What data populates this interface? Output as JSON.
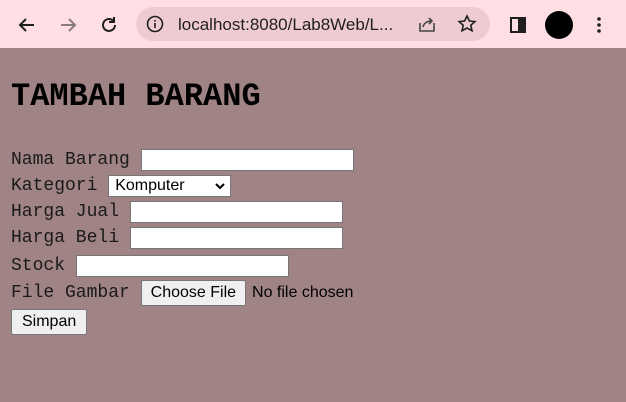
{
  "browser": {
    "url": "localhost:8080/Lab8Web/L...",
    "icons": {
      "back": "back-arrow-icon",
      "forward": "forward-arrow-icon",
      "reload": "reload-icon",
      "site_info": "site-info-icon",
      "share": "share-icon",
      "bookmark": "star-icon",
      "side_panel": "side-panel-icon",
      "menu": "kebab-menu-icon"
    },
    "toolbar_color": "#ffdfe3"
  },
  "page": {
    "background": "#a08384",
    "title": "TAMBAH BARANG",
    "form": {
      "nama_barang": {
        "label": "Nama Barang",
        "value": ""
      },
      "kategori": {
        "label": "Kategori",
        "selected": "Komputer"
      },
      "harga_jual": {
        "label": "Harga Jual",
        "value": ""
      },
      "harga_beli": {
        "label": "Harga Beli",
        "value": ""
      },
      "stock": {
        "label": "Stock",
        "value": ""
      },
      "file_gambar": {
        "label": "File Gambar",
        "button": "Choose File",
        "status": "No file chosen"
      },
      "submit_label": "Simpan"
    }
  }
}
